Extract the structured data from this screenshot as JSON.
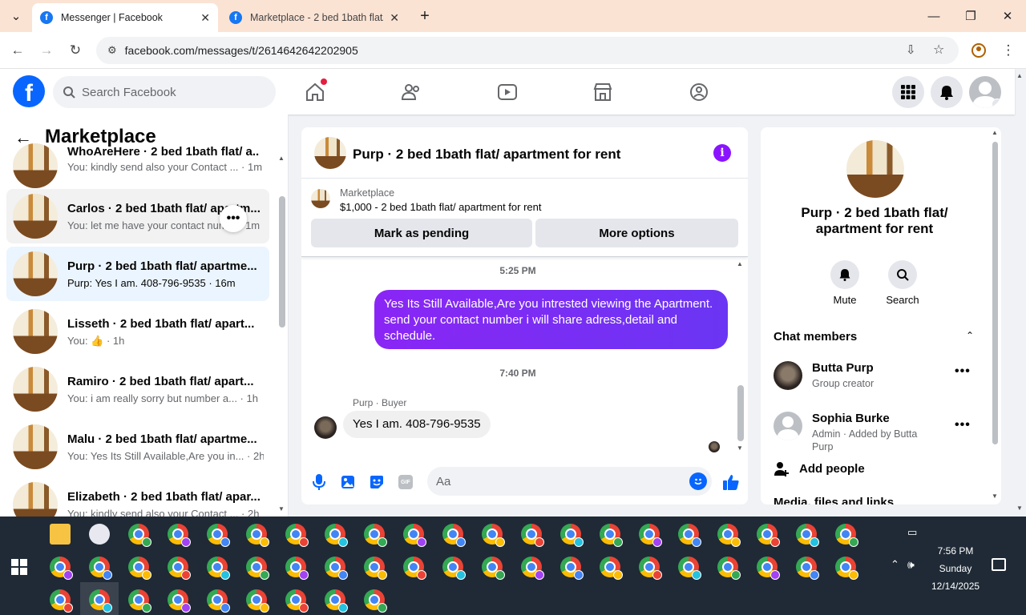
{
  "browser": {
    "tabs": [
      {
        "title": "Messenger | Facebook",
        "active": true
      },
      {
        "title": "Marketplace - 2 bed 1bath flat/",
        "active": false
      }
    ],
    "url": "facebook.com/messages/t/2614642642202905"
  },
  "fb": {
    "search_placeholder": "Search Facebook"
  },
  "left": {
    "title": "Marketplace",
    "conversations": [
      {
        "name": "WhoAreHere · 2 bed 1bath flat/ a...",
        "preview": "You: kindly send also your Contact ... · 1m"
      },
      {
        "name": "Carlos · 2 bed 1bath flat/ apartm...",
        "preview": "You: let me have your contact num... · 1m"
      },
      {
        "name": "Purp · 2 bed 1bath flat/ apartme...",
        "preview": "Purp: Yes I am. 408-796-9535 · 16m"
      },
      {
        "name": "Lisseth · 2 bed 1bath flat/ apart...",
        "preview": "You: 👍 · 1h"
      },
      {
        "name": "Ramiro · 2 bed 1bath flat/ apart...",
        "preview": "You: i am really sorry but number a... · 1h"
      },
      {
        "name": "Malu · 2 bed 1bath flat/ apartme...",
        "preview": "You: Yes Its Still Available,Are you in... · 2h"
      },
      {
        "name": "Elizabeth · 2 bed 1bath flat/ apar...",
        "preview": "You: kindly send also your Contact ... · 2h"
      }
    ]
  },
  "chat": {
    "title": "Purp · 2 bed 1bath flat/ apartment for rent",
    "card_label": "Marketplace",
    "card_price": "$1,000 - 2 bed 1bath flat/ apartment for rent",
    "btn_pending": "Mark as pending",
    "btn_more": "More options",
    "time1": "5:25 PM",
    "out_msg": "Yes Its Still Available,Are you intrested viewing the Apartment. send your contact number i will share adress,detail and schedule.",
    "time2": "7:40 PM",
    "sender_label": "Purp · Buyer",
    "in_msg": "Yes I am. 408-796-9535",
    "input_placeholder": "Aa"
  },
  "right": {
    "title": "Purp · 2 bed 1bath flat/ apartment for rent",
    "mute_label": "Mute",
    "search_label": "Search",
    "members_header": "Chat members",
    "members": [
      {
        "name": "Butta Purp",
        "sub": "Group creator"
      },
      {
        "name": "Sophia Burke",
        "sub": "Admin · Added by Butta Purp"
      }
    ],
    "add_people": "Add people",
    "media_label": "Media, files and links"
  },
  "taskbar": {
    "time": "7:56 PM",
    "day": "Sunday",
    "date": "12/14/2025"
  },
  "colors": {
    "fb_blue": "#0866ff",
    "messenger_purple": "#8a26f5"
  }
}
